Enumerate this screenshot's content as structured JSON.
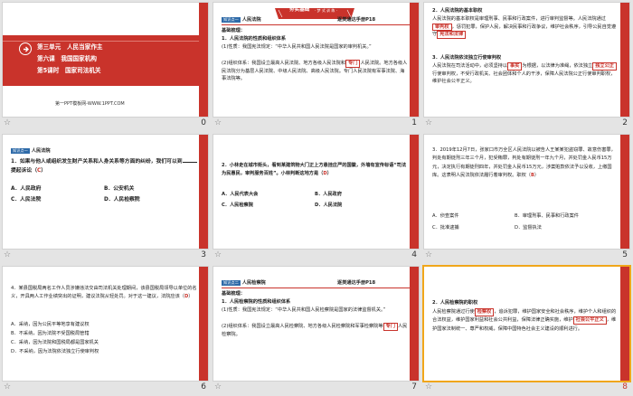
{
  "slides": [
    {
      "index": 0,
      "star": "☆",
      "num": "0"
    },
    {
      "index": 1,
      "star": "☆",
      "num": "1"
    },
    {
      "index": 2,
      "star": "☆",
      "num": "2"
    },
    {
      "index": 3,
      "star": "☆",
      "num": "3"
    },
    {
      "index": 4,
      "star": "☆",
      "num": "4"
    },
    {
      "index": 5,
      "star": "☆",
      "num": "5"
    },
    {
      "index": 6,
      "star": "☆",
      "num": "6"
    },
    {
      "index": 7,
      "star": "☆",
      "num": "7"
    },
    {
      "index": 8,
      "star": "☆",
      "num": "8"
    }
  ],
  "s0": {
    "line1": "第三单元　人民当家作主",
    "line2": "第六课　我国国家机构",
    "line3": "第5课时　国家司法机关",
    "footer": "第一PPT模板网-WWW.1PPT.COM"
  },
  "s1": {
    "header_tag": "夯实基础",
    "header_sub": "· 梦 式 训 练 ·",
    "tag": "知识点一",
    "title": "人民法院",
    "right": "逐类通达手册P18",
    "sub": "基础梳理：",
    "h1": "1．人民法院的性质和组织体系",
    "p1": "(1)性质：我国宪法规定：“中华人民共和国人民法院是国家的审判机关。”",
    "p2a": "(2)组织体系：我国设立最高人民法院、地方各级人民法院和",
    "p2box": "专门",
    "p2b": "人民法院。地方各级人民法院分为基层人民法院、中级人民法院、高级人民法院。专门人民法院有军事法院、海事法院等。"
  },
  "s2": {
    "h2": "2．人民法院的基本职权",
    "p1a": "人民法院的基本职权是审理刑事、民事和行政案件，进行审判监督等。人民法院通过",
    "p1box": "审判权",
    "p1b": "，惩罚犯罪，保护人民，解决民事和行政争议，维护社会秩序，引导公民自觉遵守",
    "p1box2": "宪法和法律",
    "h3": "3．人民法院依法独立行使审判权",
    "p2a": "人民法院在司法活动中，必须坚持以",
    "p2box": "事实",
    "p2b": "为根据，以法律为准绳，依法独立",
    "p2box2": "独立公正",
    "p2c": "行使审判权，不受行政机关、社会团体和个人的干涉，保障人民法院公正行使审判职权，维护社会公平正义。"
  },
  "s3": {
    "tag": "知识点一",
    "title": "人民法院",
    "q": "1．如果与他人或组织发生财产关系和人身关系等方面的纠纷，我们可以到",
    "blank": "",
    "q2": "提起诉讼（",
    "ans": "C",
    "q3": "）",
    "A": "A．人民政府",
    "B": "B．公安机关",
    "C": "C．人民法院",
    "D": "D．人民检察院"
  },
  "s4": {
    "q": "2．小林走在城市街头，看到某建筑物大门正上方悬挂庄严的国徽，外墙有宣传标语“司法为民惠民，审判服务百姓”。小林判断这地方是（",
    "ans": "D",
    "q3": "）",
    "A": "A．人民代表大会",
    "B": "B．人民政府",
    "C": "C．人民检察院",
    "D": "D．人民法院"
  },
  "s5": {
    "q": "3．2019年12月7日，张家口市万全区人民法院以被告人王某某犯盗窃罪、故意伤害罪，判处有期徒刑三年三个月，犯受贿罪，判处有期徒刑一年九个月，并处罚金人民币15万元，决定执行有期徒刑四年，并处罚金人民币15万元，涉案赃款依法予以没收，上缴国库。这表明人民法院依法履行着审判权。职权（",
    "ans": "B",
    "q3": "）",
    "A": "A．侦查案件",
    "B": "B．审理刑事、民事和行政案件",
    "C": "C．批准逮捕",
    "D": "D．监督执法"
  },
  "s6": {
    "q": "4．某县国税局两名工作人员涉嫌违法交由司法机关处理期间，该县国税局领导以单位的名义，开具两人工作业绩突出的证明，建议法院从轻处罚。对于这一建议，法院应该（",
    "ans": "D",
    "q3": "）",
    "A": "A．采纳，因为公民平等地享有建议权",
    "B": "B．不采纳，因为法院不受国税局管辖",
    "C": "C．采纳，因为法院和国税局都是国家机关",
    "D": "D．不采纳，因为法院依法独立行使审判权"
  },
  "s7": {
    "tag": "知识点二",
    "title": "人民检察院",
    "right": "逐类通达手册P18",
    "sub": "基础梳理：",
    "h1": "1．人民检察院的性质和组织体系",
    "p1": "(1)性质：我国宪法规定：“中华人民共和国人民检察院是国家的法律监督机关。”",
    "p2a": "(2)组织体系：我国设立最高人民检察院、地方各级人民检察院和军事检察院等",
    "p2box": "专门",
    "p2b": "人民检察院。"
  },
  "s8": {
    "h2": "2．人民检察院的职权",
    "p1a": "人民检察院通过行使",
    "p1box": "检察权",
    "p1b": "，追诉犯罪，维护国家安全和社会秩序，维护个人和组织的合法权益，维护国家利益和社会公共利益，保障法律正确实施，维护",
    "p1box2": "社会公平正义",
    "p1c": "，维护国家法制统一、尊严和权威，保障中国特色社会主义建设的顺利进行。"
  }
}
